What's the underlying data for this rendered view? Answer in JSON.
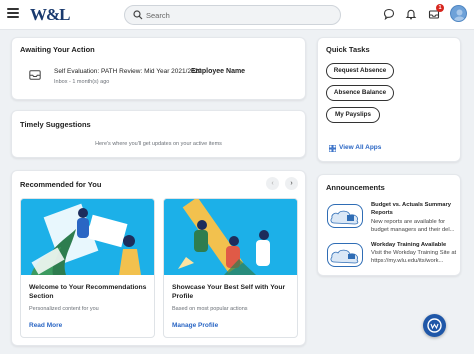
{
  "header": {
    "logo_text": "W&L",
    "search_placeholder": "Search",
    "inbox_badge": "1"
  },
  "awaiting": {
    "title": "Awaiting Your Action",
    "task": "Self Evaluation: PATH Review: Mid Year 2021/2022:",
    "assignee": "Employee Name",
    "meta": "Inbox - 1 month(s) ago"
  },
  "timely": {
    "title": "Timely Suggestions",
    "message": "Here's where you'll get updates on your active items"
  },
  "recommended": {
    "title": "Recommended for You",
    "prev_icon": "‹",
    "next_icon": "›",
    "cards": [
      {
        "title": "Welcome to Your Recommendations Section",
        "subtitle": "Personalized content for you",
        "link": "Read More"
      },
      {
        "title": "Showcase Your Best Self with Your Profile",
        "subtitle": "Based on most popular actions",
        "link": "Manage Profile"
      }
    ]
  },
  "quicktasks": {
    "title": "Quick Tasks",
    "buttons": [
      "Request Absence",
      "Absence Balance",
      "My Payslips"
    ],
    "all_apps": "View All Apps"
  },
  "announcements": {
    "title": "Announcements",
    "items": [
      {
        "title": "Budget vs. Actuals Summary Reports",
        "body": "New reports are available for budget managers and their del...",
        "icon_label": "Budget vs Actuals"
      },
      {
        "title": "Workday Training Available",
        "body": "Visit the Workday Training Site at https://my.wlu.edu/its/work...",
        "icon_label": "Training Available"
      }
    ]
  },
  "colors": {
    "accent": "#2a66c4",
    "brand": "#1a3a6e",
    "badge": "#d7261e",
    "illustration_bg": "#1cb0e8"
  }
}
